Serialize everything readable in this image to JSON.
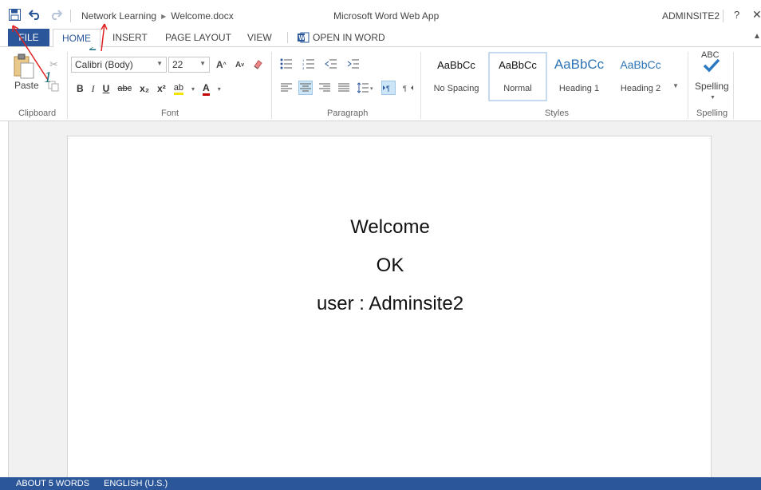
{
  "titlebar": {
    "breadcrumb_site": "Network Learning",
    "breadcrumb_file": "Welcome.docx",
    "app_title": "Microsoft Word Web App",
    "user": "ADMINSITE2",
    "help": "?",
    "close": "✕"
  },
  "tabs": {
    "file": "FILE",
    "home": "HOME",
    "insert": "INSERT",
    "page_layout": "PAGE LAYOUT",
    "view": "VIEW",
    "open_in_word": "OPEN IN WORD"
  },
  "ribbon": {
    "clipboard": {
      "paste": "Paste",
      "label": "Clipboard"
    },
    "font": {
      "name": "Calibri (Body)",
      "size": "22",
      "label": "Font",
      "bold": "B",
      "italic": "I",
      "underline": "U",
      "strike": "abc",
      "subscript": "x₂",
      "superscript": "x²",
      "highlight": "ab",
      "color": "A",
      "grow": "A",
      "shrink": "A"
    },
    "paragraph": {
      "label": "Paragraph"
    },
    "styles": {
      "label": "Styles",
      "items": [
        {
          "sample": "AaBbCc",
          "name": "No Spacing"
        },
        {
          "sample": "AaBbCc",
          "name": "Normal"
        },
        {
          "sample": "AaBbCc",
          "name": "Heading 1"
        },
        {
          "sample": "AaBbCc",
          "name": "Heading 2"
        }
      ]
    },
    "spelling": {
      "abc": "ABC",
      "button": "Spelling",
      "label": "Spelling"
    }
  },
  "document": {
    "lines": [
      "Welcome",
      "OK",
      "user : Adminsite2"
    ]
  },
  "statusbar": {
    "words": "ABOUT 5 WORDS",
    "language": "ENGLISH (U.S.)"
  },
  "annotations": {
    "one": "1",
    "two": "2"
  },
  "colors": {
    "brand": "#2b579a",
    "annotation_arrow": "#e02020",
    "annotation_number": "#1a6e7a"
  },
  "icons": [
    "save-icon",
    "undo-icon",
    "redo-icon",
    "word-icon",
    "paste-icon",
    "cut-icon",
    "copy-icon",
    "clear-format-icon",
    "bullets-icon",
    "numbering-icon",
    "decrease-indent-icon",
    "increase-indent-icon",
    "align-left-icon",
    "align-center-icon",
    "align-right-icon",
    "justify-icon",
    "line-spacing-icon",
    "ltr-icon",
    "rtl-icon",
    "check-icon"
  ]
}
